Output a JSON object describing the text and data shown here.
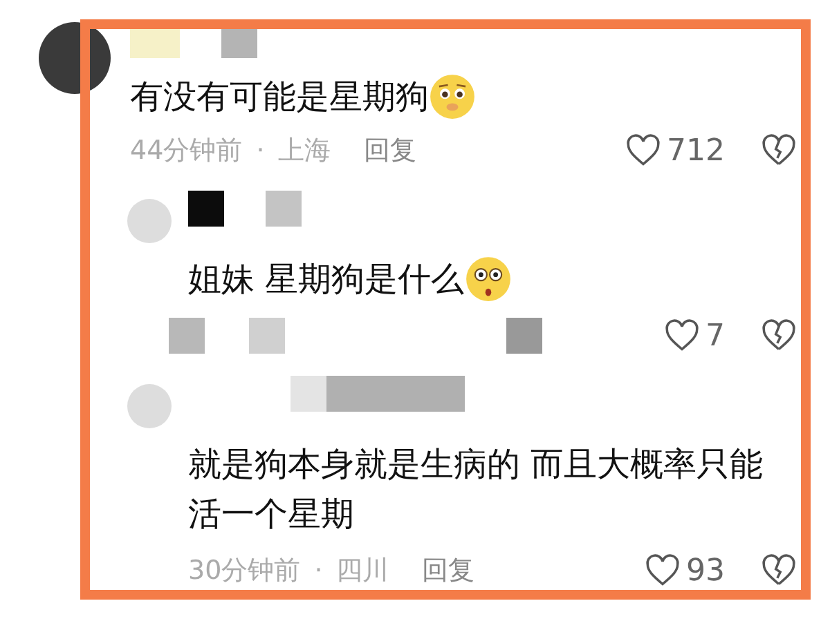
{
  "comments": [
    {
      "kind": "top",
      "text": "有没有可能是星期狗",
      "emoji": true,
      "time": "44分钟前",
      "dot": "·",
      "location": "上海",
      "reply": "回复",
      "likes": "712"
    },
    {
      "kind": "reply",
      "text": "姐妹 星期狗是什么",
      "emoji": true,
      "likes": "7"
    },
    {
      "kind": "reply",
      "text": "就是狗本身就是生病的 而且大概率只能活一个星期",
      "emoji": false,
      "time": "30分钟前",
      "dot": "·",
      "location": "四川",
      "reply": "回复",
      "likes": "93"
    }
  ]
}
